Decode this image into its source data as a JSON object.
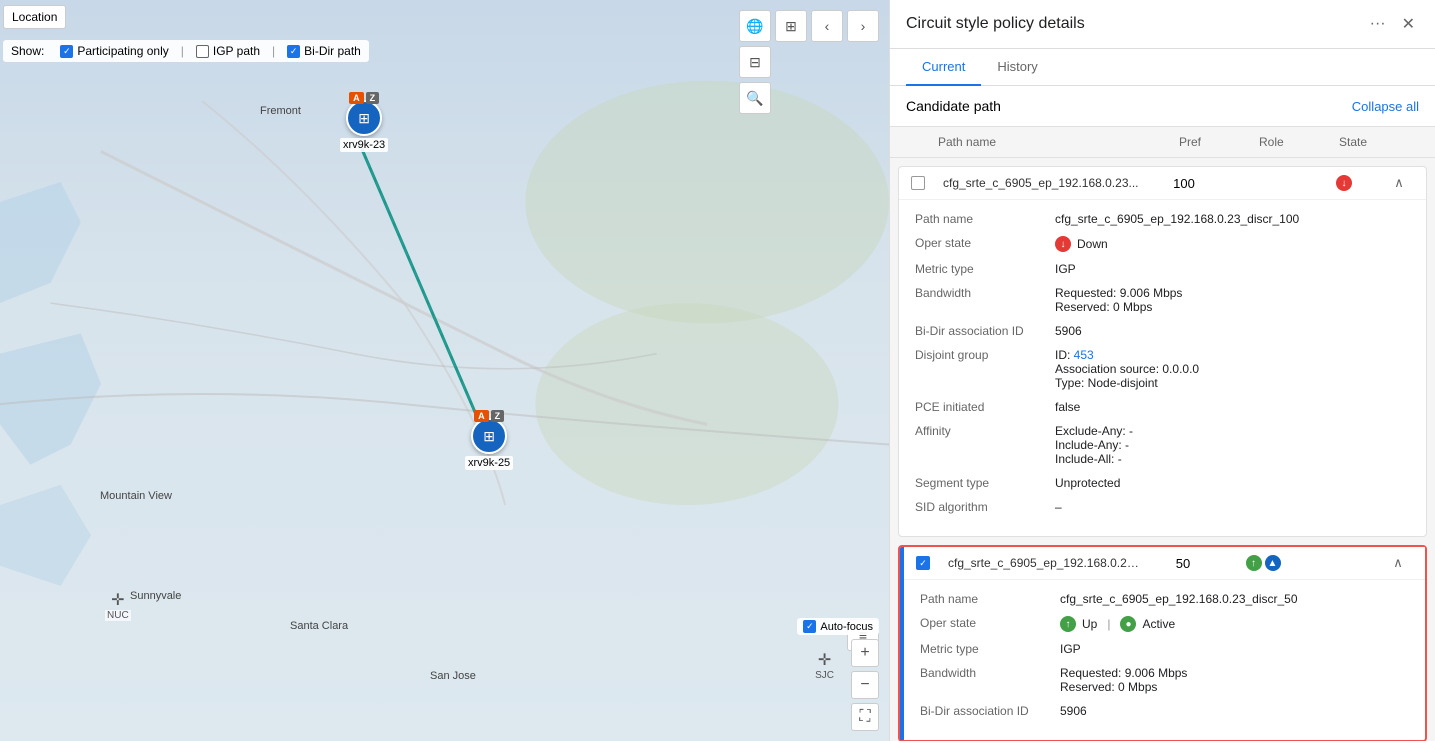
{
  "location": {
    "label": "Location"
  },
  "show_controls": {
    "label": "Show:",
    "items": [
      {
        "id": "participating-only",
        "label": "Participating only",
        "checked": true
      },
      {
        "id": "igp-path",
        "label": "IGP path",
        "checked": false
      },
      {
        "id": "bi-dir-path",
        "label": "Bi-Dir path",
        "checked": true
      }
    ]
  },
  "map_nodes": [
    {
      "id": "xrv9k-23",
      "label": "xrv9k-23",
      "badges": [
        "A",
        "Z"
      ],
      "icon": "⊞"
    },
    {
      "id": "xrv9k-25",
      "label": "xrv9k-25",
      "badges": [
        "A",
        "Z"
      ],
      "icon": "⊞"
    }
  ],
  "map_city_labels": [
    {
      "name": "Fremont"
    },
    {
      "name": "Mountain View"
    },
    {
      "name": "Santa Clara"
    },
    {
      "name": "San Jose"
    },
    {
      "name": "Sunnyvale"
    }
  ],
  "panel": {
    "title": "Circuit style policy details",
    "tabs": [
      {
        "id": "current",
        "label": "Current",
        "active": true
      },
      {
        "id": "history",
        "label": "History",
        "active": false
      }
    ],
    "section_title": "Candidate path",
    "collapse_all": "Collapse all",
    "table_headers": {
      "path_name": "Path name",
      "pref": "Pref",
      "role": "Role",
      "state": "State"
    },
    "paths": [
      {
        "id": "path1",
        "name_short": "cfg_srte_c_6905_ep_192.168.0.23...",
        "name_full": "cfg_srte_c_6905_ep_192.168.0.23_discr_100",
        "pref": "100",
        "role": "",
        "state": "down",
        "selected": false,
        "expanded": true,
        "details": {
          "path_name": "cfg_srte_c_6905_ep_192.168.0.23_discr_100",
          "oper_state": "Down",
          "oper_state_status": "down",
          "metric_type": "IGP",
          "bandwidth_requested": "Requested: 9.006 Mbps",
          "bandwidth_reserved": "Reserved: 0 Mbps",
          "bidir_assoc_id": "5906",
          "disjoint_group_id": "453",
          "disjoint_assoc_source": "Association source: 0.0.0.0",
          "disjoint_type": "Type: Node-disjoint",
          "pce_initiated": "false",
          "affinity_exclude": "Exclude-Any: -",
          "affinity_include_any": "Include-Any: -",
          "affinity_include_all": "Include-All: -",
          "segment_type": "Unprotected",
          "sid_algorithm": "–"
        }
      },
      {
        "id": "path2",
        "name_short": "cfg_srte_c_6905_ep_192.168.0.23...",
        "name_full": "cfg_srte_c_6905_ep_192.168.0.23_discr_50",
        "pref": "50",
        "role_icons": [
          "up",
          "active"
        ],
        "state": "up_active",
        "selected": true,
        "expanded": true,
        "details": {
          "path_name": "cfg_srte_c_6905_ep_192.168.0.23_discr_50",
          "oper_state": "Up",
          "oper_state_status": "up",
          "oper_state_active": "Active",
          "metric_type": "IGP",
          "bandwidth_requested": "Requested: 9.006 Mbps",
          "bandwidth_reserved": "Reserved: 0 Mbps",
          "bidir_assoc_id": "5906"
        }
      }
    ]
  },
  "icons": {
    "globe": "🌐",
    "layers": "⊟",
    "search": "🔍",
    "chevron_left": "‹",
    "chevron_right": "›",
    "more": "···",
    "close": "✕",
    "chevron_up": "∧",
    "chevron_down": "∨",
    "list": "≡",
    "zoom_in": "+",
    "zoom_out": "−",
    "expand": "⛶"
  },
  "nuc_marker": {
    "label": "NUC"
  },
  "sjc_marker": {
    "label": "SJC"
  },
  "auto_focus": {
    "label": "Auto-focus",
    "checked": true
  }
}
